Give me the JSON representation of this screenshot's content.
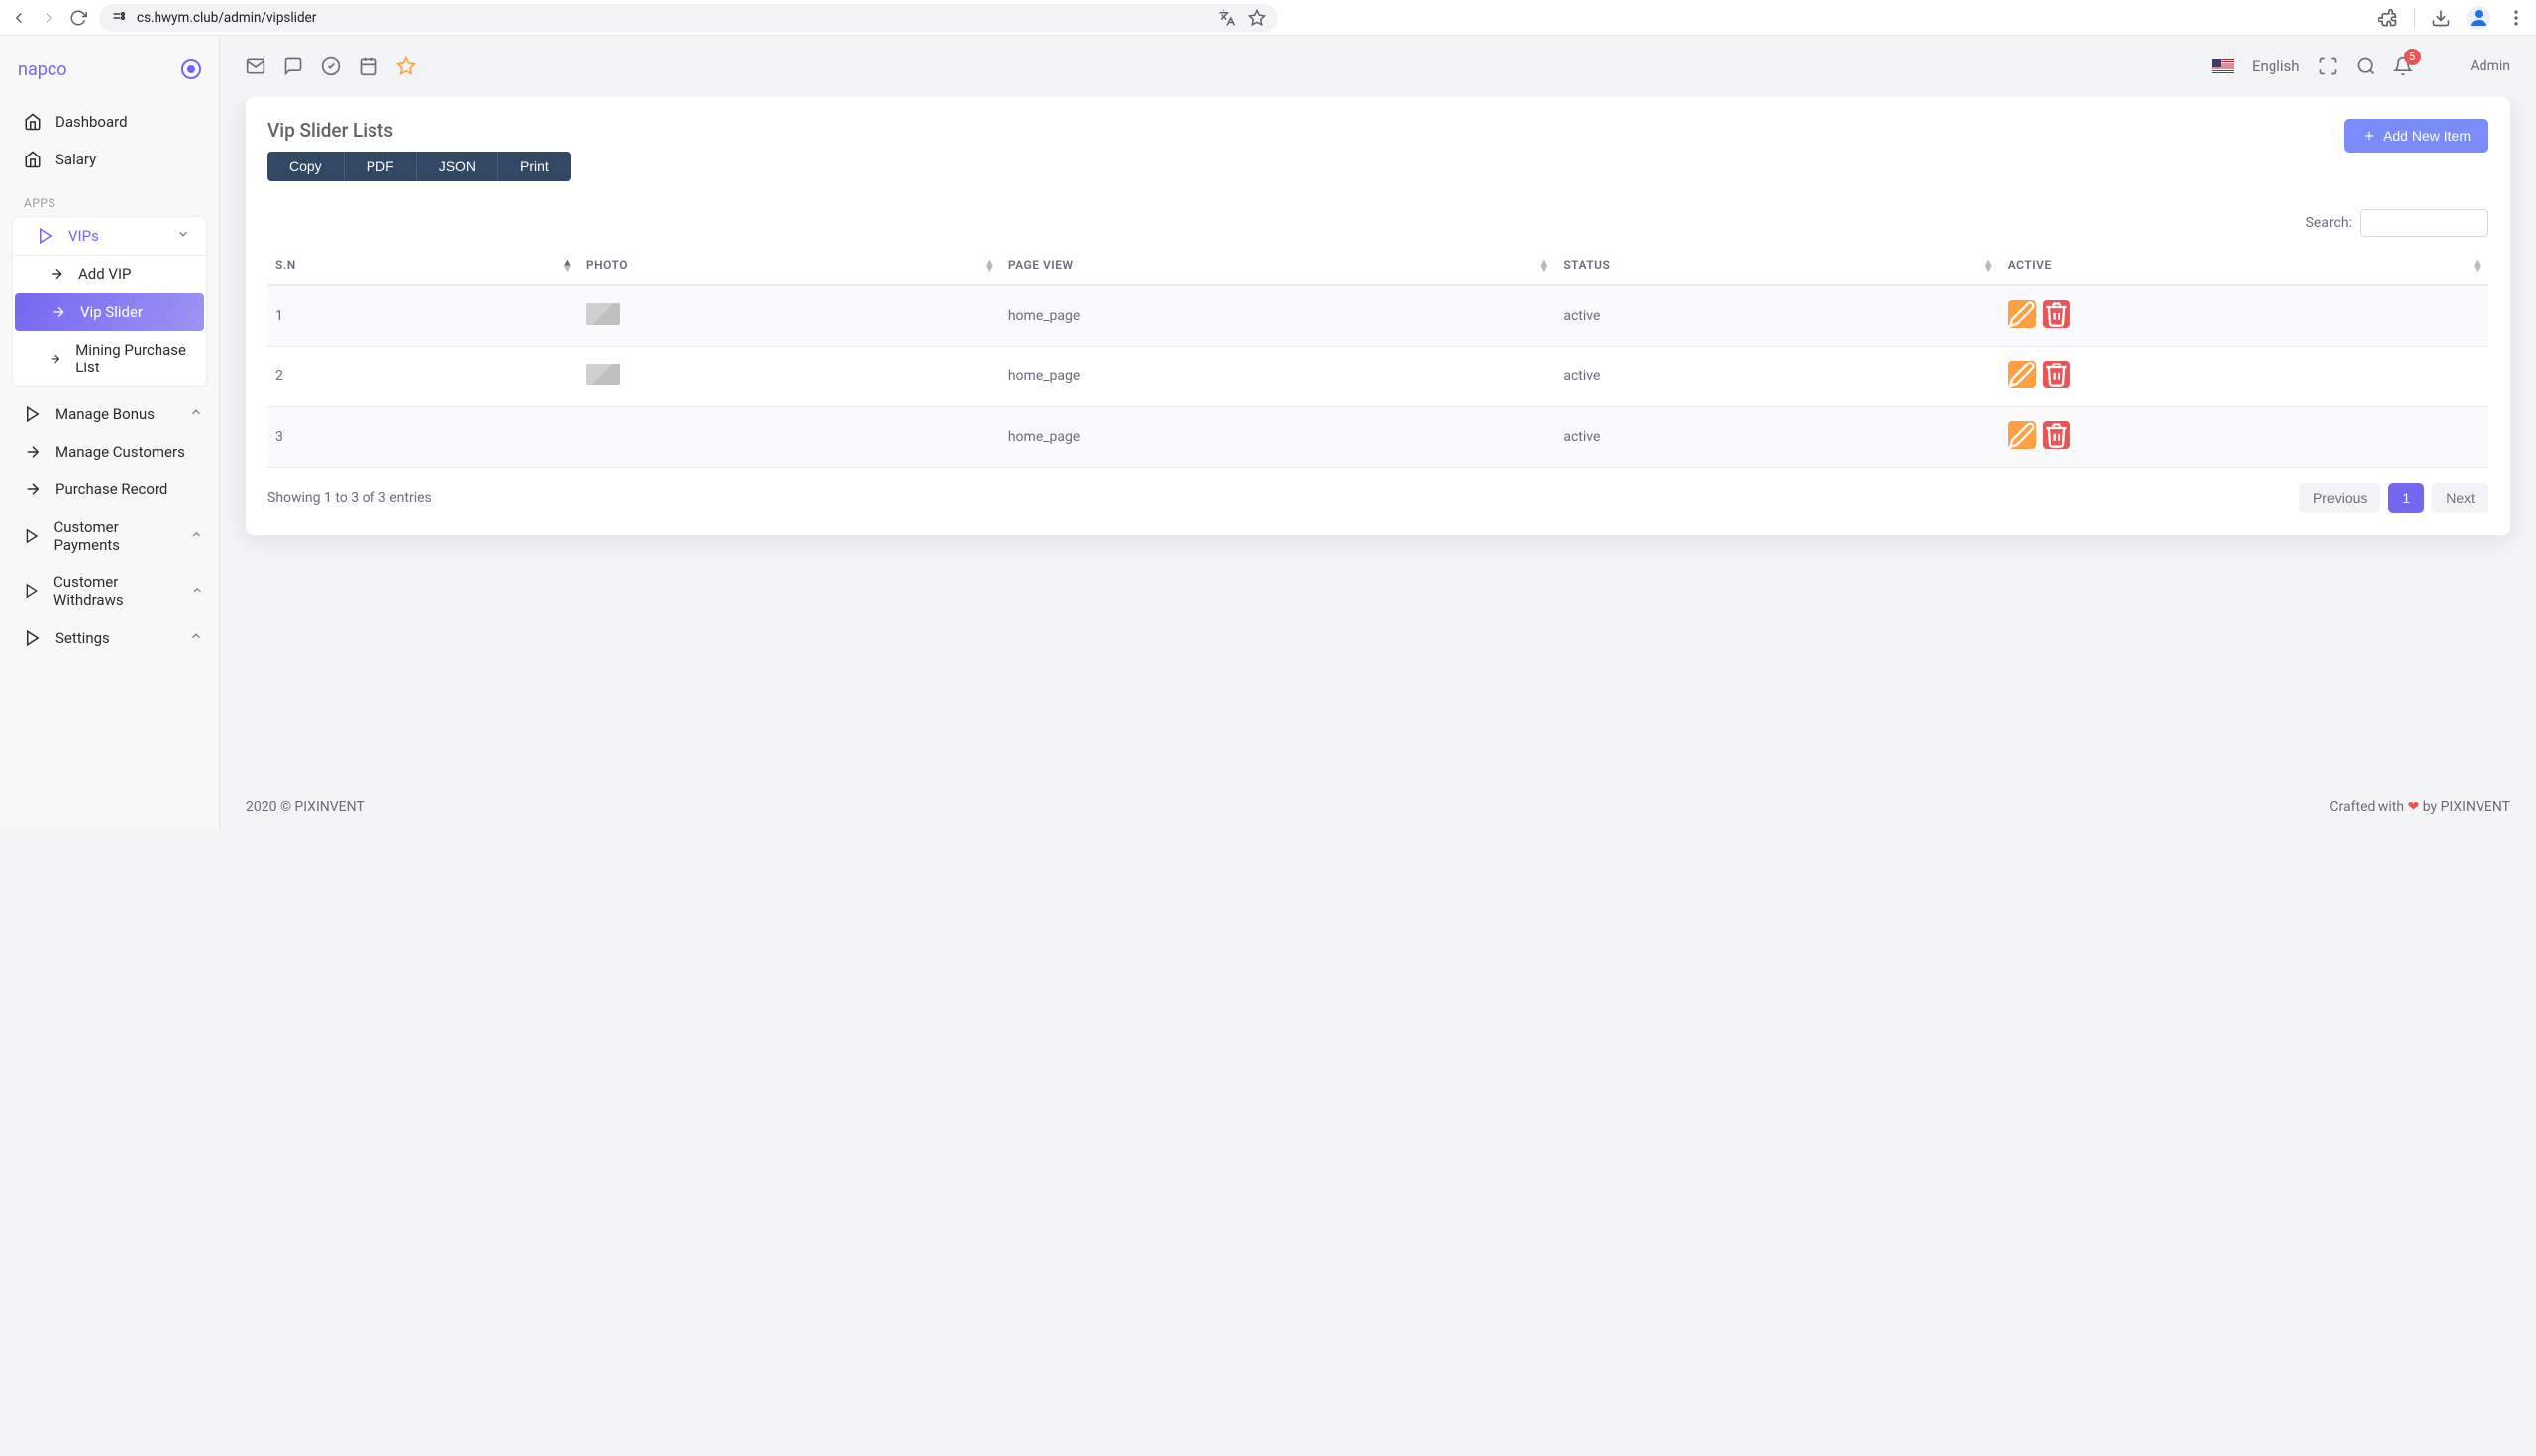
{
  "browser": {
    "url": "cs.hwym.club/admin/vipslider"
  },
  "brand": "napco",
  "sidebar": {
    "dashboard": "Dashboard",
    "salary": "Salary",
    "section_apps": "APPS",
    "vips": "VIPs",
    "add_vip": "Add VIP",
    "vip_slider": "Vip Slider",
    "mining_purchase": "Mining Purchase List",
    "manage_bonus": "Manage Bonus",
    "manage_customers": "Manage Customers",
    "purchase_record": "Purchase Record",
    "customer_payments": "Customer Payments",
    "customer_withdraws": "Customer Withdraws",
    "settings": "Settings"
  },
  "topbar": {
    "language": "English",
    "notification_count": "5",
    "user_name": "Admin"
  },
  "page": {
    "title": "Vip Slider Lists",
    "add_button": "Add New Item",
    "export": {
      "copy": "Copy",
      "pdf": "PDF",
      "json": "JSON",
      "print": "Print"
    },
    "search_label": "Search:",
    "columns": {
      "sn": "S.N",
      "photo": "PHOTO",
      "page_view": "PAGE VIEW",
      "status": "STATUS",
      "active": "ACTIVE"
    },
    "rows": [
      {
        "sn": "1",
        "page_view": "home_page",
        "status": "active"
      },
      {
        "sn": "2",
        "page_view": "home_page",
        "status": "active"
      },
      {
        "sn": "3",
        "page_view": "home_page",
        "status": "active"
      }
    ],
    "entries_info": "Showing 1 to 3 of 3 entries",
    "pagination": {
      "prev": "Previous",
      "page": "1",
      "next": "Next"
    }
  },
  "footer": {
    "copyright": "2020 © PIXINVENT",
    "crafted_pre": "Crafted with",
    "crafted_post": "by PIXINVENT"
  }
}
